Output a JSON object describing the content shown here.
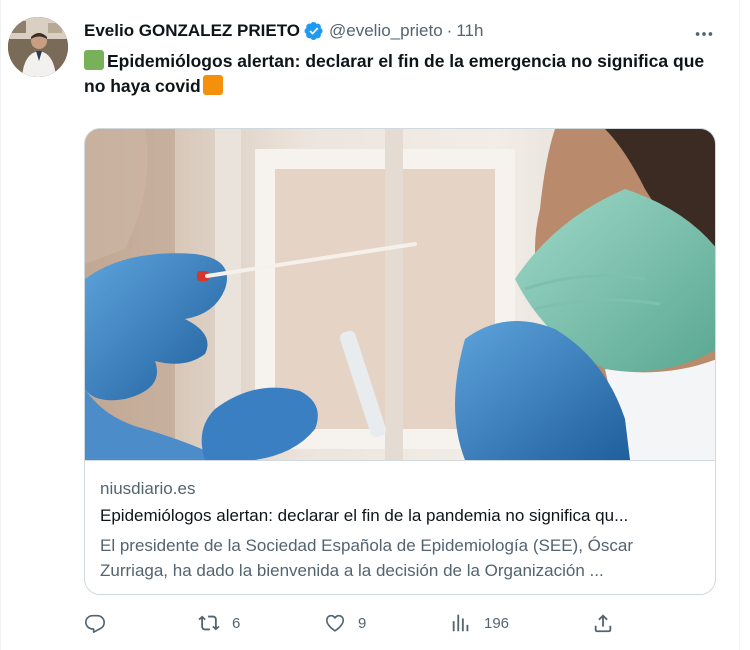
{
  "author": {
    "name": "Evelio GONZALEZ PRIETO",
    "handle": "@evelio_prieto",
    "separator": "·",
    "time": "11h",
    "verified_icon": "verified-badge-icon",
    "verified_color": "#1d9bf0"
  },
  "tweet": {
    "text": "Epidemiólogos alertan: declarar el fin de la emergencia no significa que no haya covid",
    "leading_emoji": "green-square",
    "trailing_emoji": "orange-square"
  },
  "card": {
    "domain": "niusdiario.es",
    "title": "Epidemiólogos alertan: declarar el fin de la pandemia no significa qu...",
    "description": "El presidente de la Sociedad Española de Epidemiología (SEE), Óscar Zurriaga, ha dado la bienvenida a la decisión de la Organización ..."
  },
  "actions": {
    "reply": {
      "icon": "reply-icon",
      "count": ""
    },
    "retweet": {
      "icon": "retweet-icon",
      "count": "6"
    },
    "like": {
      "icon": "heart-icon",
      "count": "9"
    },
    "views": {
      "icon": "views-icon",
      "count": "196"
    },
    "share": {
      "icon": "share-icon",
      "count": ""
    }
  },
  "colors": {
    "text_primary": "#0f1419",
    "text_secondary": "#536471",
    "border": "#cfd9de",
    "accent": "#1d9bf0"
  }
}
